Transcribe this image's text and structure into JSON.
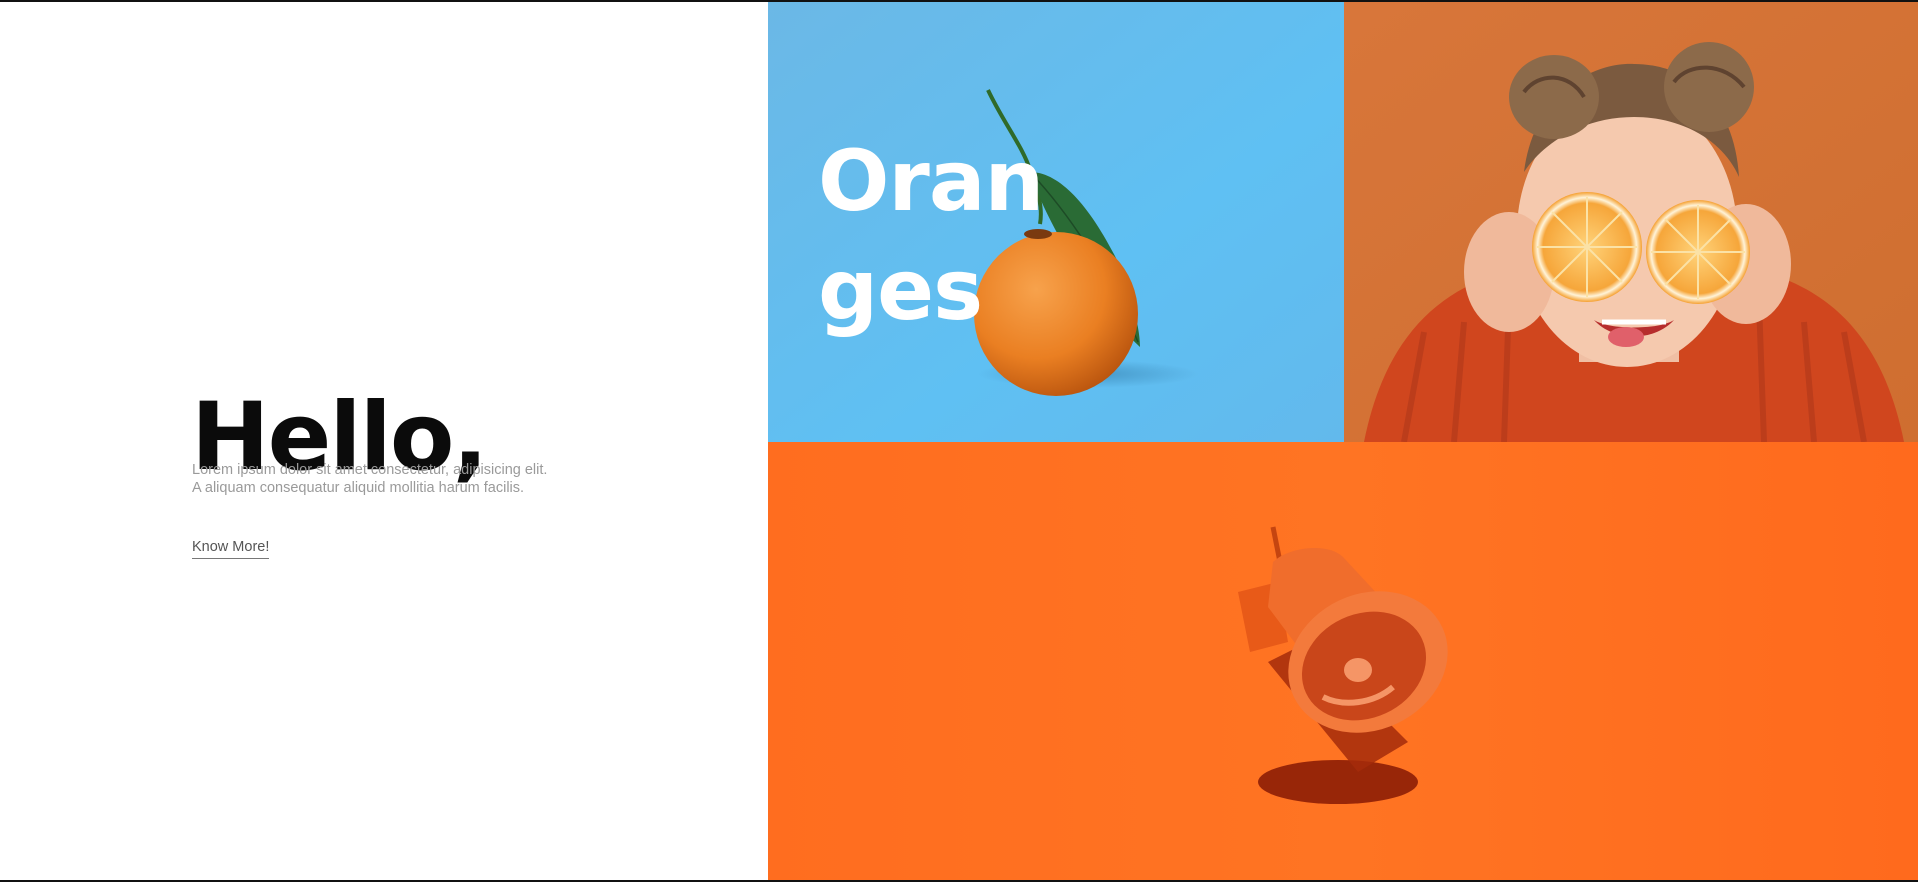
{
  "hero": {
    "heading": "Hello,",
    "description_line1": "Lorem ipsum dolor sit amet consectetur, adipisicing elit.",
    "description_line2": "A aliquam consequatur aliquid mollitia harum facilis.",
    "cta_label": "Know More!"
  },
  "gallery": {
    "oranges_title_line1": "Oran",
    "oranges_title_line2": "ges",
    "tiles": [
      {
        "name": "oranges-tile",
        "background": "#5ab9ee"
      },
      {
        "name": "girl-with-oranges-tile",
        "background": "#d9783a"
      },
      {
        "name": "megaphone-tile",
        "background": "#ff6f22"
      }
    ]
  },
  "colors": {
    "heading": "#0b0b0b",
    "text_muted": "#9a9a9a",
    "orange_accent": "#ff6f22",
    "sky_blue": "#5ab9ee"
  }
}
